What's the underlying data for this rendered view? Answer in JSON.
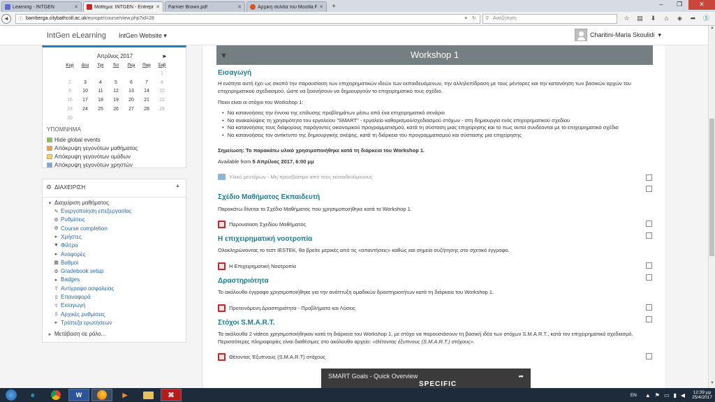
{
  "browser": {
    "tabs": [
      {
        "title": "Learning - INTGEN",
        "color": "#5b6bd1"
      },
      {
        "title": "Μάθημα: INTGEN - Entrepren",
        "color": "#c62828"
      },
      {
        "title": "Farmer Brown.pdf",
        "color": ""
      },
      {
        "title": "Αρχική σελίδα του Mozilla Fi",
        "color": "#d9541e"
      }
    ],
    "new_tab": "+",
    "url_domain": "bamberga.citybathcoll.ac.uk",
    "url_path": "/europe/course/view.php?id=28",
    "search_placeholder": "Αναζήτηση"
  },
  "header": {
    "brand": "IntGen eLearning",
    "site_menu": "IntGen Website",
    "user_name": "Charitini-Maria Skoulidi"
  },
  "calendar": {
    "month": "Απρίλιος 2017",
    "prev": "◄",
    "next": "►",
    "weekdays": [
      "Κυρ",
      "Δευ",
      "Τρι",
      "Τετ",
      "Πεμ",
      "Παρ",
      "Σαβ"
    ],
    "weeks": [
      [
        "",
        "",
        "",
        "",
        "",
        "",
        "1"
      ],
      [
        "2",
        "3",
        "4",
        "5",
        "6",
        "7",
        "8"
      ],
      [
        "9",
        "10",
        "11",
        "12",
        "13",
        "14",
        "15"
      ],
      [
        "16",
        "17",
        "18",
        "19",
        "20",
        "21",
        "22"
      ],
      [
        "23",
        "24",
        "25",
        "26",
        "27",
        "28",
        "29"
      ],
      [
        "30",
        "",
        "",
        "",
        "",
        "",
        ""
      ]
    ]
  },
  "legend": {
    "title": "ΥΠΟΜΝΗΜΑ",
    "items": [
      {
        "label": "Hide global events",
        "color": "#8dbf5a"
      },
      {
        "label": "Απόκρυψη γεγονότων μαθήματος",
        "color": "#e8a04f"
      },
      {
        "label": "Απόκρυψη γεγονότων ομάδων",
        "color": "#f5d36b"
      },
      {
        "label": "Απόκρυψη γεγονότων χρηστών",
        "color": "#7fa7d6"
      }
    ]
  },
  "admin": {
    "title": "ΔΙΑΧΕΙΡΙΣΗ",
    "course_admin": "Διαχείριση μαθήματος",
    "items": [
      {
        "label": "Ενεργοποίηση επεξεργασίας",
        "icon": "pencil-icon",
        "glyph": "✎"
      },
      {
        "label": "Ρυθμίσεις",
        "icon": "gear-icon",
        "glyph": "⚙"
      },
      {
        "label": "Course completion",
        "icon": "gear-icon",
        "glyph": "⚙"
      },
      {
        "label": "Χρήστες",
        "icon": "expand-arrow-icon",
        "glyph": "▸"
      },
      {
        "label": "Φίλτρα",
        "icon": "filter-icon",
        "glyph": "▼"
      },
      {
        "label": "Αναφορές",
        "icon": "expand-arrow-icon",
        "glyph": "▸"
      },
      {
        "label": "Βαθμοί",
        "icon": "grades-icon",
        "glyph": "▦"
      },
      {
        "label": "Gradebook setup",
        "icon": "gear-icon",
        "glyph": "⚙"
      },
      {
        "label": "Badges",
        "icon": "expand-arrow-icon",
        "glyph": "▸"
      },
      {
        "label": "Αντίγραφο ασφαλείας",
        "icon": "backup-icon",
        "glyph": "⇪"
      },
      {
        "label": "Επαναφορά",
        "icon": "restore-icon",
        "glyph": "⇫"
      },
      {
        "label": "Εισαγωγή",
        "icon": "import-icon",
        "glyph": "⇪"
      },
      {
        "label": "Αρχικές ρυθμίσεις",
        "icon": "reset-icon",
        "glyph": "⇫"
      },
      {
        "label": "Τράπεζα ερωτήσεων",
        "icon": "expand-arrow-icon",
        "glyph": "▸"
      }
    ],
    "switch_role": "Μετάβαση σε ρόλο..."
  },
  "main": {
    "section_title": "Workshop 1",
    "intro": {
      "heading": "Εισαγωγή",
      "text": "Η ενότητα αυτή έχει ως σκοπό την παρουσίαση των επιχειρηματικών ιδεών των εκπαιδευόμενων, την αλληλεπίδραση με τους μέντορες και την κατανόηση των βασικών αρχών του επιχειρηματικού σχεδιασμού, ώστε να ξεκινήσουν να δημιουργούν το επιχειρηματικό τους σχέδιο.",
      "goals_intro": "Ποιοι είναι οι στόχοι του Workshop 1:",
      "goals": [
        "Να κατανοήσεις την έννοια της επίλυσης προβλημάτων μέσω από ένα επιχειρηματικό σενάριο",
        "Να ανακαλύψεις τη χρησιμότητα του εργαλείου \"SMART\" - εργαλείο καθορισμού/σχεδιασμού στόχων - στη δημιουργία ενός επιχειρηματικού σχεδίου",
        "Να κατανοήσεις τους διάφορους παράγοντες οικονομικού προγραμματισμού, κατά τη σύσταση μιας επιχείρησης και το πως αυτοί συνδέονται με το επιχειρηματικό σχέδιο",
        "Να κατανοήσεις τον αντίκτυπο της δημιουργικής σκέψης, κατά τη διάρκεια του προγραμματισμού και σύστασης μια επιχείρησης"
      ],
      "note": "Σημείωση: Το παρακάτω υλικό χρησιμοποιήθηκε κατά τη διάρκεια του Workshop 1.",
      "available_prefix": "Available from ",
      "available_date": "5 Απρίλιος 2017, 6:00 μμ",
      "folder": "Υλικό μεντόρων - Μη προσβάσιμο από τους εκπαιδευόμενους"
    },
    "lesson_plan": {
      "heading": "Σχέδιο Μαθήματος Εκπαιδευτή",
      "text": "Παρακάτω δίνεται το Σχέδιο Μαθήματος που χρησιμοποιήθηκε κατά το Workshop 1.",
      "resource": "Παρουσίαση Σχεδίου Μαθήματος"
    },
    "mindset": {
      "heading": "Η επιχειρηματική νοοτροπία",
      "text": "Ολοκληρώνοντας το τεστ IESTEK, θα βρείτε μερικές από τις «απαντήσεις» καθώς και σημεία συζήτησης στο σχετικό έγγραφο.",
      "resource": "Η Επιχειρηματική Νοοτροπία"
    },
    "activity": {
      "heading": "Δραστηριότητα",
      "text": "Το ακόλουθο έγγραφο χρησιμοποιήθηκε για την ανάπτυξη ομαδικών δραστηριοτήτων κατά τη διάρκεια του Workshop 1.",
      "resource": "Προτεινόμενη Δραστηριότητα - Προβλήματα και Λύσεις"
    },
    "smart": {
      "heading": "Στόχοι S.M.A.R.T.",
      "text": "Τα ακόλουθα 2 videos χρησιμοποιήθηκαν κατά τη διάρκεια του Workshop 1, με στόχο να παρουσιάσουν τη βασική ιδέα των στόχων S.M.A.R.T., κατά τον επιχειρηματικό σχεδιασμό. Περισσότερες πληροφορίες είναι διαθέσιμες στο ακόλουθο αρχείο: ",
      "text_em": "«Θέτοντας έξυπνους (S.M.A.R.T.) στόχους»",
      "text_end": ".",
      "resource": "Θέτοντας Έξυπνους (S.M.A.R.T) στόχους",
      "video_title": "SMART Goals - Quick Overview",
      "video_brand": "SPECIFIC"
    }
  },
  "taskbar": {
    "lang": "EN",
    "time": "12:39 μμ",
    "date": "25/4/2017"
  }
}
